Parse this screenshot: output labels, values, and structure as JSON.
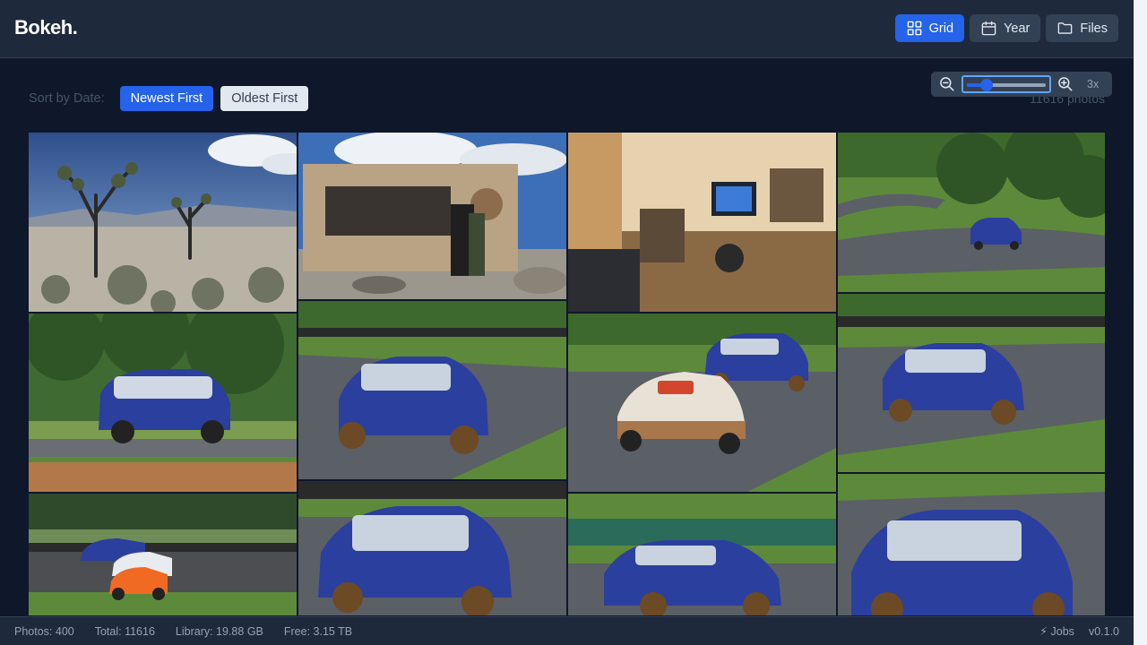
{
  "app": {
    "name": "Bokeh."
  },
  "header": {
    "views": [
      {
        "label": "Grid",
        "icon": "grid-icon",
        "active": true
      },
      {
        "label": "Year",
        "icon": "calendar-icon",
        "active": false
      },
      {
        "label": "Files",
        "icon": "folder-icon",
        "active": false
      }
    ]
  },
  "sort": {
    "label": "Sort by Date:",
    "newest": "Newest First",
    "oldest": "Oldest First",
    "selected": "newest"
  },
  "zoom": {
    "value_label": "3x",
    "level": 0.25
  },
  "photo_count": "11616 photos",
  "photos": [
    {
      "subject": "joshua-trees-desert"
    },
    {
      "subject": "joshua-tree-park-sign"
    },
    {
      "subject": "workshop-desk"
    },
    {
      "subject": "blue-hatchback-track-distant"
    },
    {
      "subject": "blue-hatchback-track"
    },
    {
      "subject": "blue-hatchback-number-11"
    },
    {
      "subject": "race-car-and-hatchback"
    },
    {
      "subject": "blue-hatchback-number-13"
    },
    {
      "subject": "track-pack-racing"
    },
    {
      "subject": "blue-hatchback-number-13-closeup"
    },
    {
      "subject": "blue-hatchback-side"
    },
    {
      "subject": "blue-hatchback-front"
    }
  ],
  "footer": {
    "photos": "Photos: 400",
    "total": "Total: 11616",
    "library": "Library: 19.88 GB",
    "free": "Free: 3.15 TB",
    "jobs": "⚡ Jobs",
    "version": "v0.1.0"
  },
  "colors": {
    "accent": "#2563eb",
    "header_bg": "#1e293b",
    "page_bg": "#0f172a",
    "car_blue": "#2b3f9e",
    "grass": "#5d8a3a",
    "asphalt": "#5b5f66"
  }
}
